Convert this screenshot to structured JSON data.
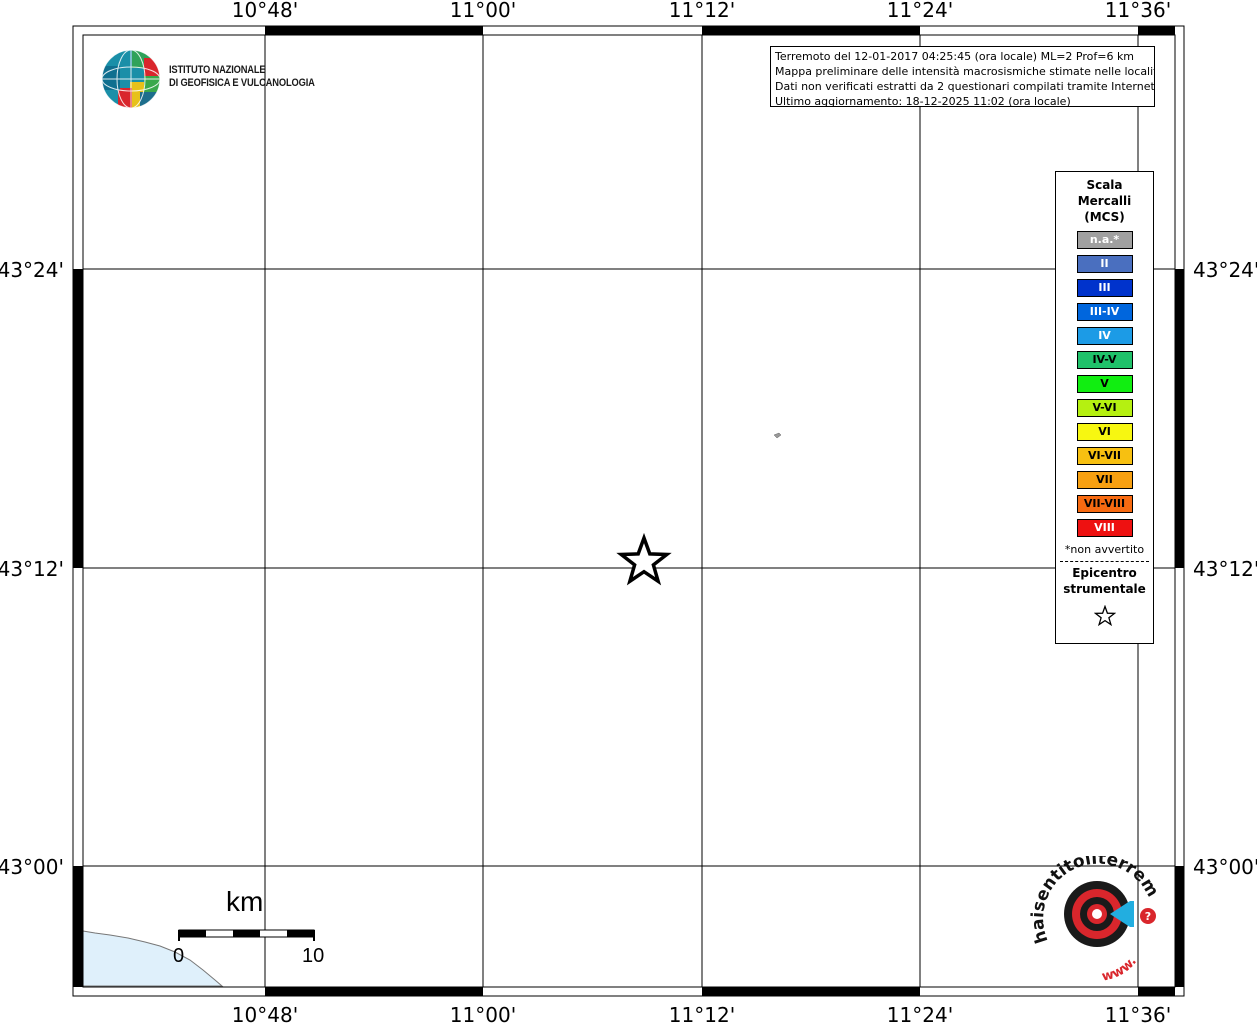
{
  "map": {
    "top_labels": [
      "10°48'",
      "11°00'",
      "11°12'",
      "11°24'",
      "11°36'"
    ],
    "bottom_labels": [
      "10°48'",
      "11°00'",
      "11°12'",
      "11°24'",
      "11°36'"
    ],
    "left_labels": [
      "43°24'",
      "43°12'",
      "43°00'"
    ],
    "right_labels": [
      "43°24'",
      "43°12'",
      "43°00'"
    ],
    "land_color": "#ffffff",
    "sea_color": "#dff0fb",
    "epicenter_icon": "star-icon"
  },
  "info": {
    "line1": "Terremoto del 12-01-2017 04:25:45 (ora locale) ML=2 Prof=6 km",
    "line2": "Mappa preliminare delle intensità macrosismiche stimate nelle località",
    "line3": "Dati non verificati estratti da 2 questionari compilati tramite Internet.",
    "line4": "Ultimo aggiornamento: 18-12-2025 11:02 (ora locale)"
  },
  "logo": {
    "line1": "ISTITUTO NAZIONALE",
    "line2": "DI GEOFISICA E VULCANOLOGIA"
  },
  "legend": {
    "title_line1": "Scala",
    "title_line2": "Mercalli",
    "title_line3": "(MCS)",
    "items": [
      {
        "label": "n.a.*",
        "color": "#a0a0a0",
        "text_color": "#ffffff"
      },
      {
        "label": "II",
        "color": "#4a6fbf",
        "text_color": "#ffffff"
      },
      {
        "label": "III",
        "color": "#0033cc",
        "text_color": "#ffffff"
      },
      {
        "label": "III-IV",
        "color": "#0066dd",
        "text_color": "#ffffff"
      },
      {
        "label": "IV",
        "color": "#1c9be6",
        "text_color": "#ffffff"
      },
      {
        "label": "IV-V",
        "color": "#1fc26a",
        "text_color": "#000000"
      },
      {
        "label": "V",
        "color": "#11ee11",
        "text_color": "#000000"
      },
      {
        "label": "V-VI",
        "color": "#b5f011",
        "text_color": "#000000"
      },
      {
        "label": "VI",
        "color": "#f7f711",
        "text_color": "#000000"
      },
      {
        "label": "VI-VII",
        "color": "#f7c011",
        "text_color": "#000000"
      },
      {
        "label": "VII",
        "color": "#f7a011",
        "text_color": "#000000"
      },
      {
        "label": "VII-VIII",
        "color": "#f76a11",
        "text_color": "#000000"
      },
      {
        "label": "VIII",
        "color": "#ee1111",
        "text_color": "#ffffff"
      }
    ],
    "note": "*non avvertito",
    "epicenter_line1": "Epicentro",
    "epicenter_line2": "strumentale"
  },
  "scale": {
    "unit": "km",
    "min": "0",
    "max": "10"
  },
  "hs_logo": {
    "text": "haisentitoilterremoto.it",
    "url": "www."
  }
}
